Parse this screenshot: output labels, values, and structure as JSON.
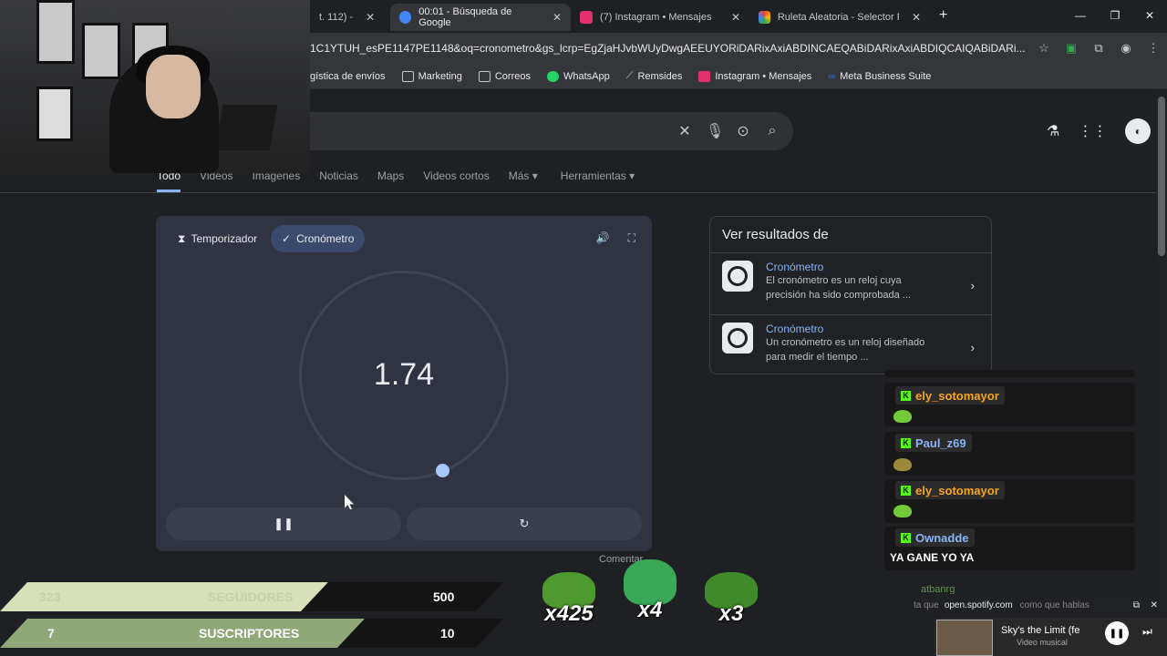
{
  "browser": {
    "tabs": [
      {
        "label": "t. 112) -",
        "active": false,
        "favicon_color": "#c4c7c5"
      },
      {
        "label": "00:01 - Búsqueda de Google",
        "active": true,
        "favicon_color": "#4285f4"
      },
      {
        "label": "(7) Instagram • Mensajes",
        "active": false,
        "favicon_color": "#e1306c"
      },
      {
        "label": "Ruleta Aleatoria - Selector Pers",
        "active": false,
        "favicon_color": "#f4b400"
      }
    ],
    "url": "1C1YTUH_esPE1147PE1148&oq=cronometro&gs_lcrp=EgZjaHJvbWUyDwgAEEUYORiDARixAxiABDINCAEQABiDARixAxiABDIQCAIQABiDARi...",
    "bookmarks": [
      {
        "label": "gística de envíos",
        "color": "#c4c7c5"
      },
      {
        "label": "Marketing",
        "color": "#c4c7c5"
      },
      {
        "label": "Correos",
        "color": "#c4c7c5"
      },
      {
        "label": "WhatsApp",
        "color": "#25d366"
      },
      {
        "label": "Remsides",
        "color": "#c4c7c5"
      },
      {
        "label": "Instagram • Mensajes",
        "color": "#e1306c"
      },
      {
        "label": "Meta Business Suite",
        "color": "#1877f2"
      }
    ]
  },
  "search_nav": [
    "Todo",
    "Videos",
    "Imágenes",
    "Noticias",
    "Maps",
    "Videos cortos",
    "Más ▾",
    "Herramientas ▾"
  ],
  "stopwatch": {
    "mode_timer": "Temporizador",
    "mode_stopwatch": "Cronómetro",
    "time": "1.74",
    "pause_icon": "pause-icon",
    "reset_icon": "reset-icon"
  },
  "results_panel": {
    "heading": "Ver resultados de",
    "items": [
      {
        "title": "Cronómetro",
        "desc": "El cronómetro es un reloj cuya precisión ha sido comprobada ..."
      },
      {
        "title": "Cronómetro",
        "desc": "Un cronómetro es un reloj diseñado para medir el tiempo ..."
      }
    ]
  },
  "chat": {
    "messages": [
      {
        "user": "ely_sotomayor",
        "user_color": "#f5a623",
        "text": ""
      },
      {
        "user": "Paul_z69",
        "user_color": "#8ab4f8",
        "text": ""
      },
      {
        "user": "ely_sotomayor",
        "user_color": "#f5a623",
        "text": ""
      },
      {
        "user": "Ownadde",
        "user_color": "#8ab4f8",
        "text": "YA GANE YO YA"
      }
    ],
    "next_user": "atbanrg"
  },
  "stream": {
    "followers_current": "323",
    "followers_label": "SEGUIDORES",
    "followers_goal": "500",
    "subs_current": "7",
    "subs_label": "SUSCRIPTORES",
    "subs_goal": "10",
    "followers_color": "#d7e0b8",
    "subs_color": "#8fa878",
    "comment_label": "Comentar",
    "emote_counts": [
      "x425",
      "x4",
      "x3"
    ]
  },
  "spotify": {
    "domain": "open.spotify.com",
    "overlay_text": "ta que",
    "overlay_text2": "como que hablas",
    "song": "Sky's the Limit (fe",
    "sub": "Video musical"
  }
}
